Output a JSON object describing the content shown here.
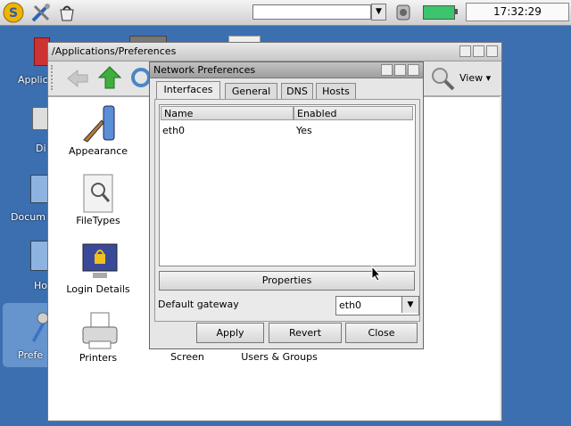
{
  "top_panel": {
    "clock": "17:32:29"
  },
  "desktop": {
    "icons": [
      {
        "label": "Applic"
      },
      {
        "label": "Di"
      },
      {
        "label": "Docum"
      },
      {
        "label": "Ho"
      },
      {
        "label": "Prefe"
      }
    ]
  },
  "file_manager": {
    "title": "/Applications/Preferences",
    "view_label": "View",
    "items": [
      {
        "label": "Appearance"
      },
      {
        "label": "FileTypes"
      },
      {
        "label": "Login Details"
      },
      {
        "label": "Printers"
      },
      {
        "label": "Screen"
      },
      {
        "label": "Users & Groups"
      }
    ]
  },
  "dialog": {
    "title": "Network Preferences",
    "tabs": [
      {
        "label": "Interfaces"
      },
      {
        "label": "General"
      },
      {
        "label": "DNS"
      },
      {
        "label": "Hosts"
      }
    ],
    "list": {
      "columns": [
        "Name",
        "Enabled"
      ],
      "rows": [
        {
          "name": "eth0",
          "enabled": "Yes"
        }
      ]
    },
    "properties_label": "Properties",
    "gateway_label": "Default gateway",
    "gateway_value": "eth0",
    "buttons": {
      "apply": "Apply",
      "revert": "Revert",
      "close": "Close"
    }
  }
}
